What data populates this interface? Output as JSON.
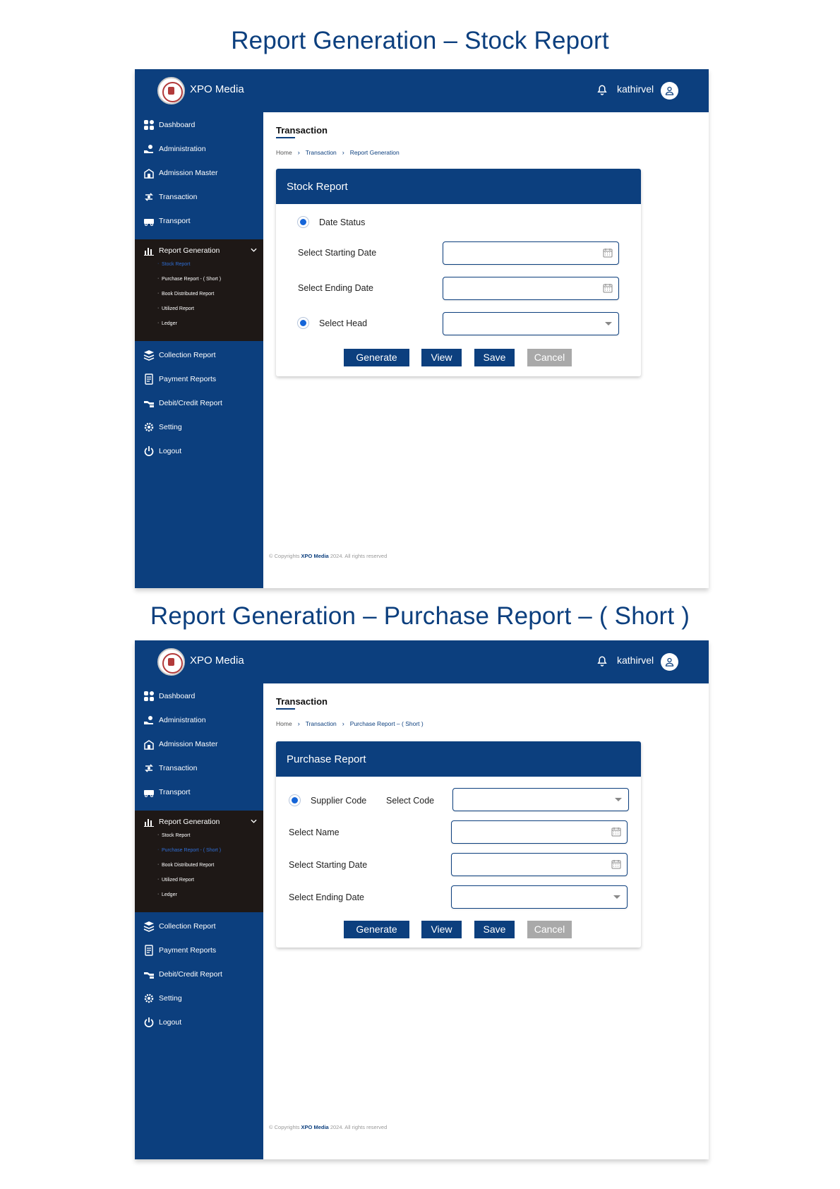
{
  "screens": [
    {
      "page_title": "Report Generation – Stock Report",
      "app_name": "XPO Media",
      "username": "kathirvel",
      "sidebar": {
        "items": [
          "Dashboard",
          "Administration",
          "Admission Master",
          "Transaction",
          "Transport",
          "Report Generation"
        ],
        "sub_items": [
          "Stock Report",
          "Purchase Report - ( Short )",
          "Book Distributed Report",
          "Utilized Report",
          "Ledger"
        ],
        "items_after": [
          "Collection Report",
          "Payment Reports",
          "Debit/Credit Report",
          "Setting",
          "Logout"
        ]
      },
      "main_title": "Transaction",
      "breadcrumb": [
        "Home",
        "Transaction",
        "Report Generation"
      ],
      "card_title": "Stock Report",
      "form": {
        "radio1": "Date Status",
        "start_label": "Select Starting Date",
        "end_label": "Select Ending Date",
        "radio2": "Select Head"
      },
      "buttons": {
        "generate": "Generate",
        "view": "View",
        "save": "Save",
        "cancel": "Cancel"
      },
      "footer": {
        "prefix": "© Copyrights ",
        "brand": "XPO Media",
        "suffix": " 2024. All rights reserved"
      }
    },
    {
      "page_title": "Report Generation – Purchase Report – ( Short )",
      "app_name": "XPO Media",
      "username": "kathirvel",
      "sidebar": {
        "items": [
          "Dashboard",
          "Administration",
          "Admission Master",
          "Transaction",
          "Transport",
          "Report Generation"
        ],
        "sub_items": [
          "Stock Report",
          "Purchase Report - ( Short )",
          "Book Distributed Report",
          "Utilized Report",
          "Ledger"
        ],
        "items_after": [
          "Collection Report",
          "Payment Reports",
          "Debit/Credit Report",
          "Setting",
          "Logout"
        ]
      },
      "main_title": "Transaction",
      "breadcrumb": [
        "Home",
        "Transaction",
        "Purchase Report – ( Short )"
      ],
      "card_title": "Purchase Report",
      "form": {
        "radio1": "Supplier Code",
        "code_label": "Select Code",
        "name_label": "Select Name",
        "start_label": "Select Starting Date",
        "end_label": "Select Ending Date"
      },
      "buttons": {
        "generate": "Generate",
        "view": "View",
        "save": "Save",
        "cancel": "Cancel"
      },
      "footer": {
        "prefix": "© Copyrights ",
        "brand": "XPO Media",
        "suffix": " 2024. All rights reserved"
      }
    }
  ],
  "sidebar_active_sub": [
    0,
    1
  ],
  "icons": {
    "sidebar": [
      "dashboard-icon",
      "administration-icon",
      "admission-master-icon",
      "transaction-icon",
      "transport-icon",
      "report-generation-icon"
    ],
    "sidebar_after": [
      "collection-report-icon",
      "payment-reports-icon",
      "debit-credit-report-icon",
      "setting-icon",
      "logout-icon"
    ],
    "header": [
      "bell-icon",
      "user-avatar-icon"
    ]
  },
  "colors": {
    "primary": "#0c3f7e",
    "submenu_bg": "#1e1816",
    "active_link": "#2f6ed6",
    "cancel": "#a9a9a9"
  }
}
